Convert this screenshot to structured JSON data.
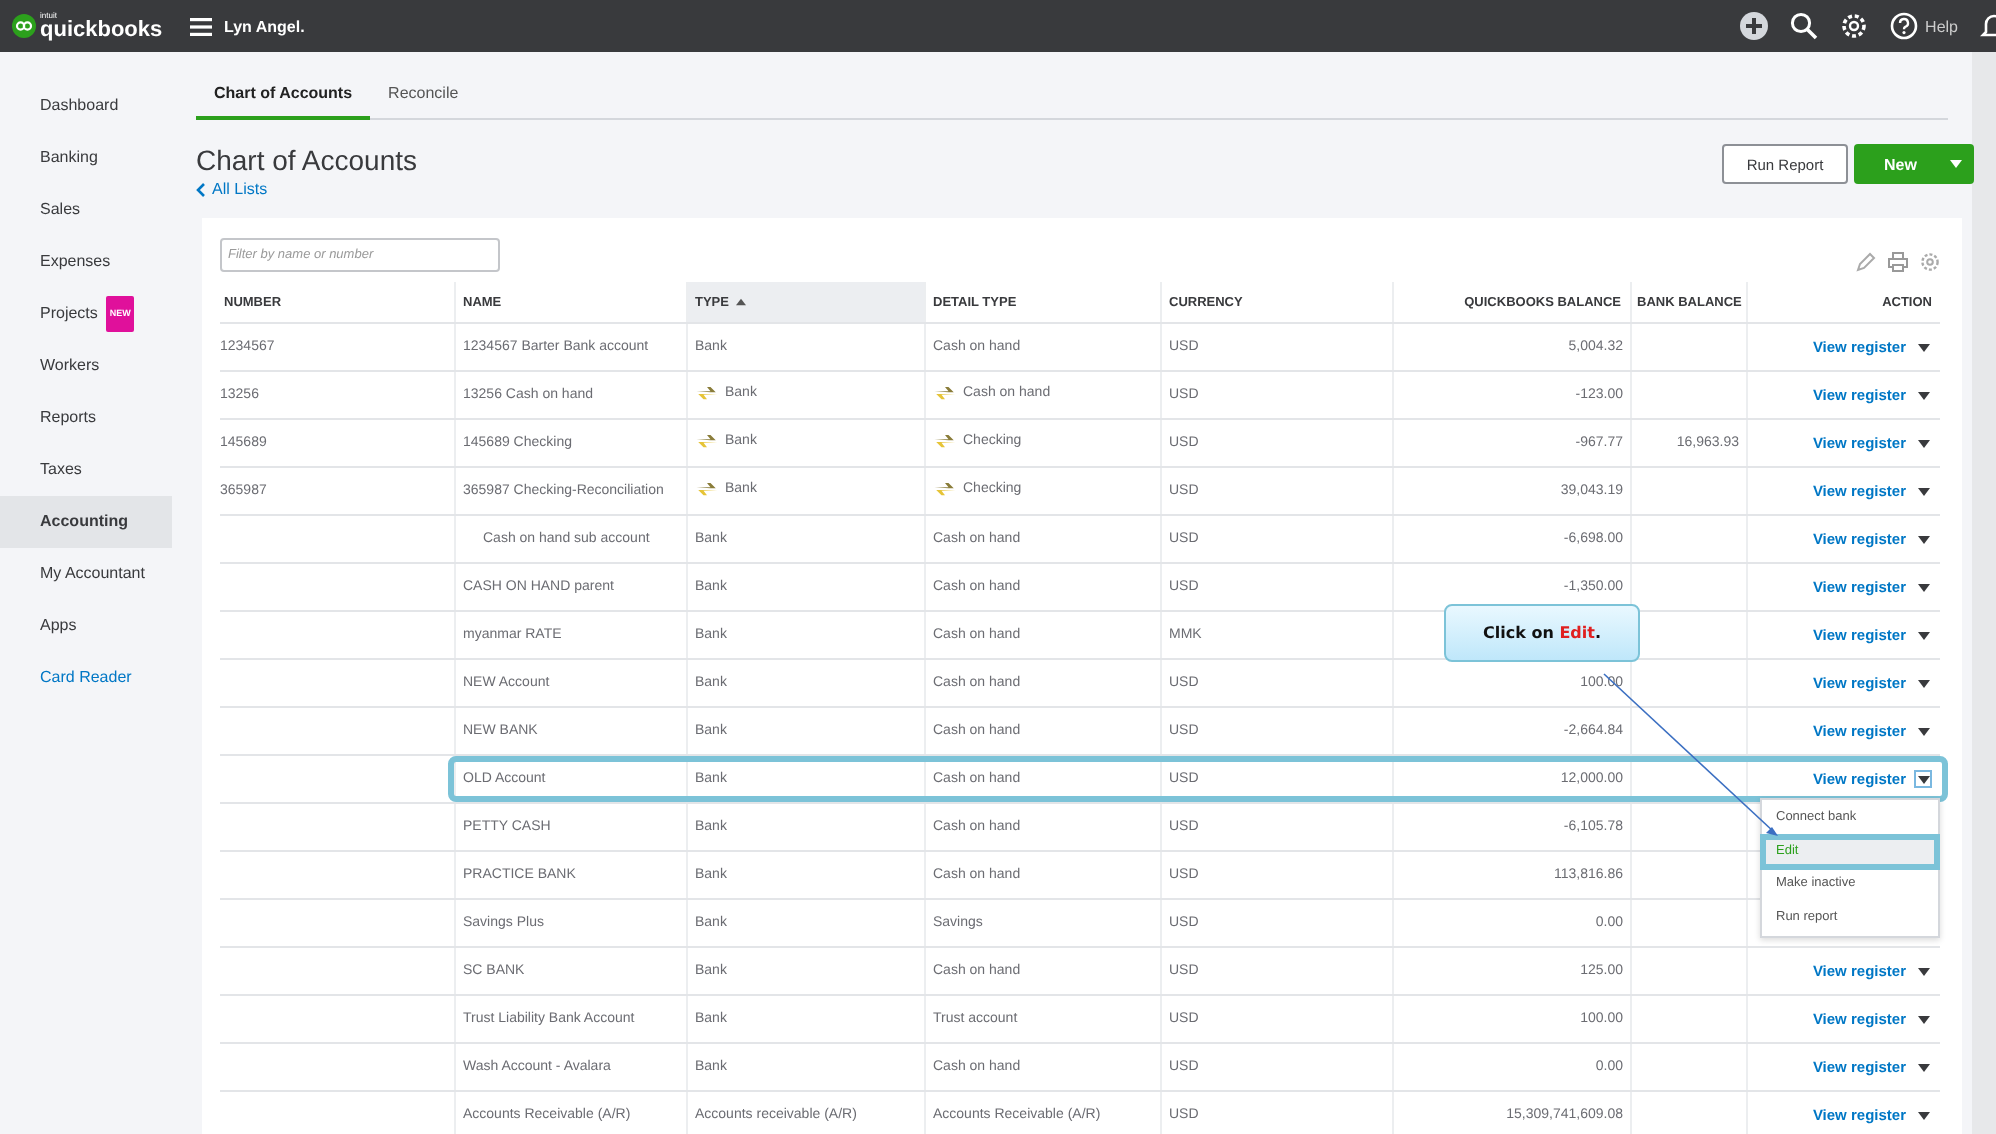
{
  "topbar": {
    "brand_small": "intuit",
    "brand": "quickbooks",
    "company": "Lyn Angel.",
    "help": "Help"
  },
  "sidebar": {
    "items": [
      {
        "label": "Dashboard",
        "selected": false,
        "kind": "item"
      },
      {
        "label": "Banking",
        "selected": false,
        "kind": "item"
      },
      {
        "label": "Sales",
        "selected": false,
        "kind": "item"
      },
      {
        "label": "Expenses",
        "selected": false,
        "kind": "item"
      },
      {
        "label": "Projects",
        "selected": false,
        "badge": "NEW",
        "kind": "item"
      },
      {
        "label": "Workers",
        "selected": false,
        "kind": "item"
      },
      {
        "label": "Reports",
        "selected": false,
        "kind": "item"
      },
      {
        "label": "Taxes",
        "selected": false,
        "kind": "item"
      },
      {
        "label": "Accounting",
        "selected": true,
        "kind": "item"
      },
      {
        "label": "My Accountant",
        "selected": false,
        "kind": "item"
      },
      {
        "label": "Apps",
        "selected": false,
        "kind": "item"
      },
      {
        "label": "Card Reader",
        "selected": false,
        "kind": "link"
      }
    ]
  },
  "tabs": [
    {
      "label": "Chart of Accounts",
      "selected": true
    },
    {
      "label": "Reconcile",
      "selected": false
    }
  ],
  "page": {
    "title": "Chart of Accounts",
    "back_link": "All Lists",
    "buttons": {
      "run_report": "Run Report",
      "new": "New"
    }
  },
  "table": {
    "filter": {
      "placeholder": "Filter by name or number"
    },
    "columns": [
      {
        "label": "NUMBER",
        "sorted": false
      },
      {
        "label": "NAME",
        "sorted": false
      },
      {
        "label": "TYPE",
        "sorted": true
      },
      {
        "label": "DETAIL TYPE",
        "sorted": false
      },
      {
        "label": "CURRENCY",
        "sorted": false
      },
      {
        "label": "QUICKBOOKS BALANCE",
        "sorted": false
      },
      {
        "label": "BANK BALANCE",
        "sorted": false
      },
      {
        "label": "ACTION",
        "sorted": false
      }
    ],
    "rows": [
      {
        "number": "1234567",
        "name": "1234567 Barter Bank account",
        "type": "Bank",
        "detail_type": "Cash on hand",
        "currency": "USD",
        "balance": "5,004.32",
        "action": "View register",
        "connected": false,
        "sub": false,
        "highlighted": false
      },
      {
        "number": "13256",
        "name": "13256 Cash on hand",
        "type": "Bank",
        "detail_type": "Cash on hand",
        "currency": "USD",
        "balance": "-123.00",
        "action": "View register",
        "connected": true,
        "sub": false,
        "highlighted": false
      },
      {
        "number": "145689",
        "name": "145689 Checking",
        "type": "Bank",
        "detail_type": "Checking",
        "currency": "USD",
        "balance": "-967.77",
        "bank_balance": "16,963.93",
        "action": "View register",
        "connected": true,
        "sub": false,
        "highlighted": false
      },
      {
        "number": "365987",
        "name": "365987 Checking-Reconciliation",
        "type": "Bank",
        "detail_type": "Checking",
        "currency": "USD",
        "balance": "39,043.19",
        "action": "View register",
        "connected": true,
        "sub": false,
        "highlighted": false
      },
      {
        "name": "Cash on hand sub account",
        "type": "Bank",
        "detail_type": "Cash on hand",
        "currency": "USD",
        "balance": "-6,698.00",
        "action": "View register",
        "connected": false,
        "sub": true,
        "highlighted": false
      },
      {
        "name": "CASH ON HAND parent",
        "type": "Bank",
        "detail_type": "Cash on hand",
        "currency": "USD",
        "balance": "-1,350.00",
        "action": "View register",
        "connected": false,
        "sub": false,
        "highlighted": false
      },
      {
        "name": "myanmar RATE",
        "type": "Bank",
        "detail_type": "Cash on hand",
        "currency": "MMK",
        "action": "View register",
        "connected": false,
        "sub": false,
        "highlighted": false
      },
      {
        "name": "NEW Account",
        "type": "Bank",
        "detail_type": "Cash on hand",
        "currency": "USD",
        "balance": "100.00",
        "action": "View register",
        "connected": false,
        "sub": false,
        "highlighted": false
      },
      {
        "name": "NEW BANK",
        "type": "Bank",
        "detail_type": "Cash on hand",
        "currency": "USD",
        "balance": "-2,664.84",
        "action": "View register",
        "connected": false,
        "sub": false,
        "highlighted": false
      },
      {
        "name": "OLD Account",
        "type": "Bank",
        "detail_type": "Cash on hand",
        "currency": "USD",
        "balance": "12,000.00",
        "action": "View register",
        "connected": false,
        "sub": false,
        "highlighted": true,
        "menu": [
          {
            "label": "Connect bank",
            "selected": false
          },
          {
            "label": "Edit",
            "selected": true
          },
          {
            "label": "Make inactive",
            "selected": false
          },
          {
            "label": "Run report",
            "selected": false
          }
        ]
      },
      {
        "name": "PETTY CASH",
        "type": "Bank",
        "detail_type": "Cash on hand",
        "currency": "USD",
        "balance": "-6,105.78",
        "connected": false,
        "sub": false,
        "highlighted": false
      },
      {
        "name": "PRACTICE BANK",
        "type": "Bank",
        "detail_type": "Cash on hand",
        "currency": "USD",
        "balance": "113,816.86",
        "connected": false,
        "sub": false,
        "highlighted": false
      },
      {
        "name": "Savings Plus",
        "type": "Bank",
        "detail_type": "Savings",
        "currency": "USD",
        "balance": "0.00",
        "connected": false,
        "sub": false,
        "highlighted": false
      },
      {
        "name": "SC BANK",
        "type": "Bank",
        "detail_type": "Cash on hand",
        "currency": "USD",
        "balance": "125.00",
        "action": "View register",
        "connected": false,
        "sub": false,
        "highlighted": false
      },
      {
        "name": "Trust Liability Bank Account",
        "type": "Bank",
        "detail_type": "Trust account",
        "currency": "USD",
        "balance": "100.00",
        "action": "View register",
        "connected": false,
        "sub": false,
        "highlighted": false
      },
      {
        "name": "Wash Account - Avalara",
        "type": "Bank",
        "detail_type": "Cash on hand",
        "currency": "USD",
        "balance": "0.00",
        "action": "View register",
        "connected": false,
        "sub": false,
        "highlighted": false
      },
      {
        "name": "Accounts Receivable (A/R)",
        "type": "Accounts receivable (A/R)",
        "detail_type": "Accounts Receivable (A/R)",
        "currency": "USD",
        "balance": "15,309,741,609.08",
        "action": "View register",
        "connected": false,
        "sub": false,
        "highlighted": false
      }
    ]
  },
  "callout": {
    "text": "Click on *Edit*."
  }
}
